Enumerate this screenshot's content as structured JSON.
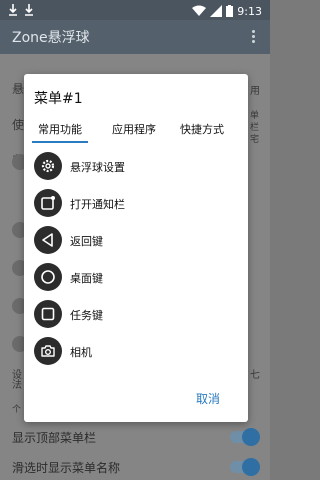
{
  "status_bar": {
    "time": "9:13"
  },
  "app_bar": {
    "title": "Zone悬浮球"
  },
  "background": {
    "rows": [
      "悬",
      "使",
      "自",
      "设",
      "法",
      "个"
    ],
    "right_fragments": [
      "用",
      "单",
      "栏",
      "宅",
      "七"
    ],
    "bottom_rows": [
      {
        "label": "显示顶部菜单栏",
        "on": true
      },
      {
        "label": "滑选时显示菜单名称",
        "on": true
      }
    ]
  },
  "dialog": {
    "title": "菜单#1",
    "tabs": [
      "常用功能",
      "应用程序",
      "快捷方式"
    ],
    "active_tab": 0,
    "items": [
      {
        "label": "悬浮球设置",
        "icon": "gear-icon"
      },
      {
        "label": "打开通知栏",
        "icon": "notification-icon"
      },
      {
        "label": "返回键",
        "icon": "back-triangle-icon"
      },
      {
        "label": "桌面键",
        "icon": "home-circle-icon"
      },
      {
        "label": "任务键",
        "icon": "recents-square-icon"
      },
      {
        "label": "相机",
        "icon": "camera-icon"
      }
    ],
    "cancel_label": "取消"
  },
  "colors": {
    "accent": "#2a7bbf",
    "appbar": "#54616c"
  }
}
